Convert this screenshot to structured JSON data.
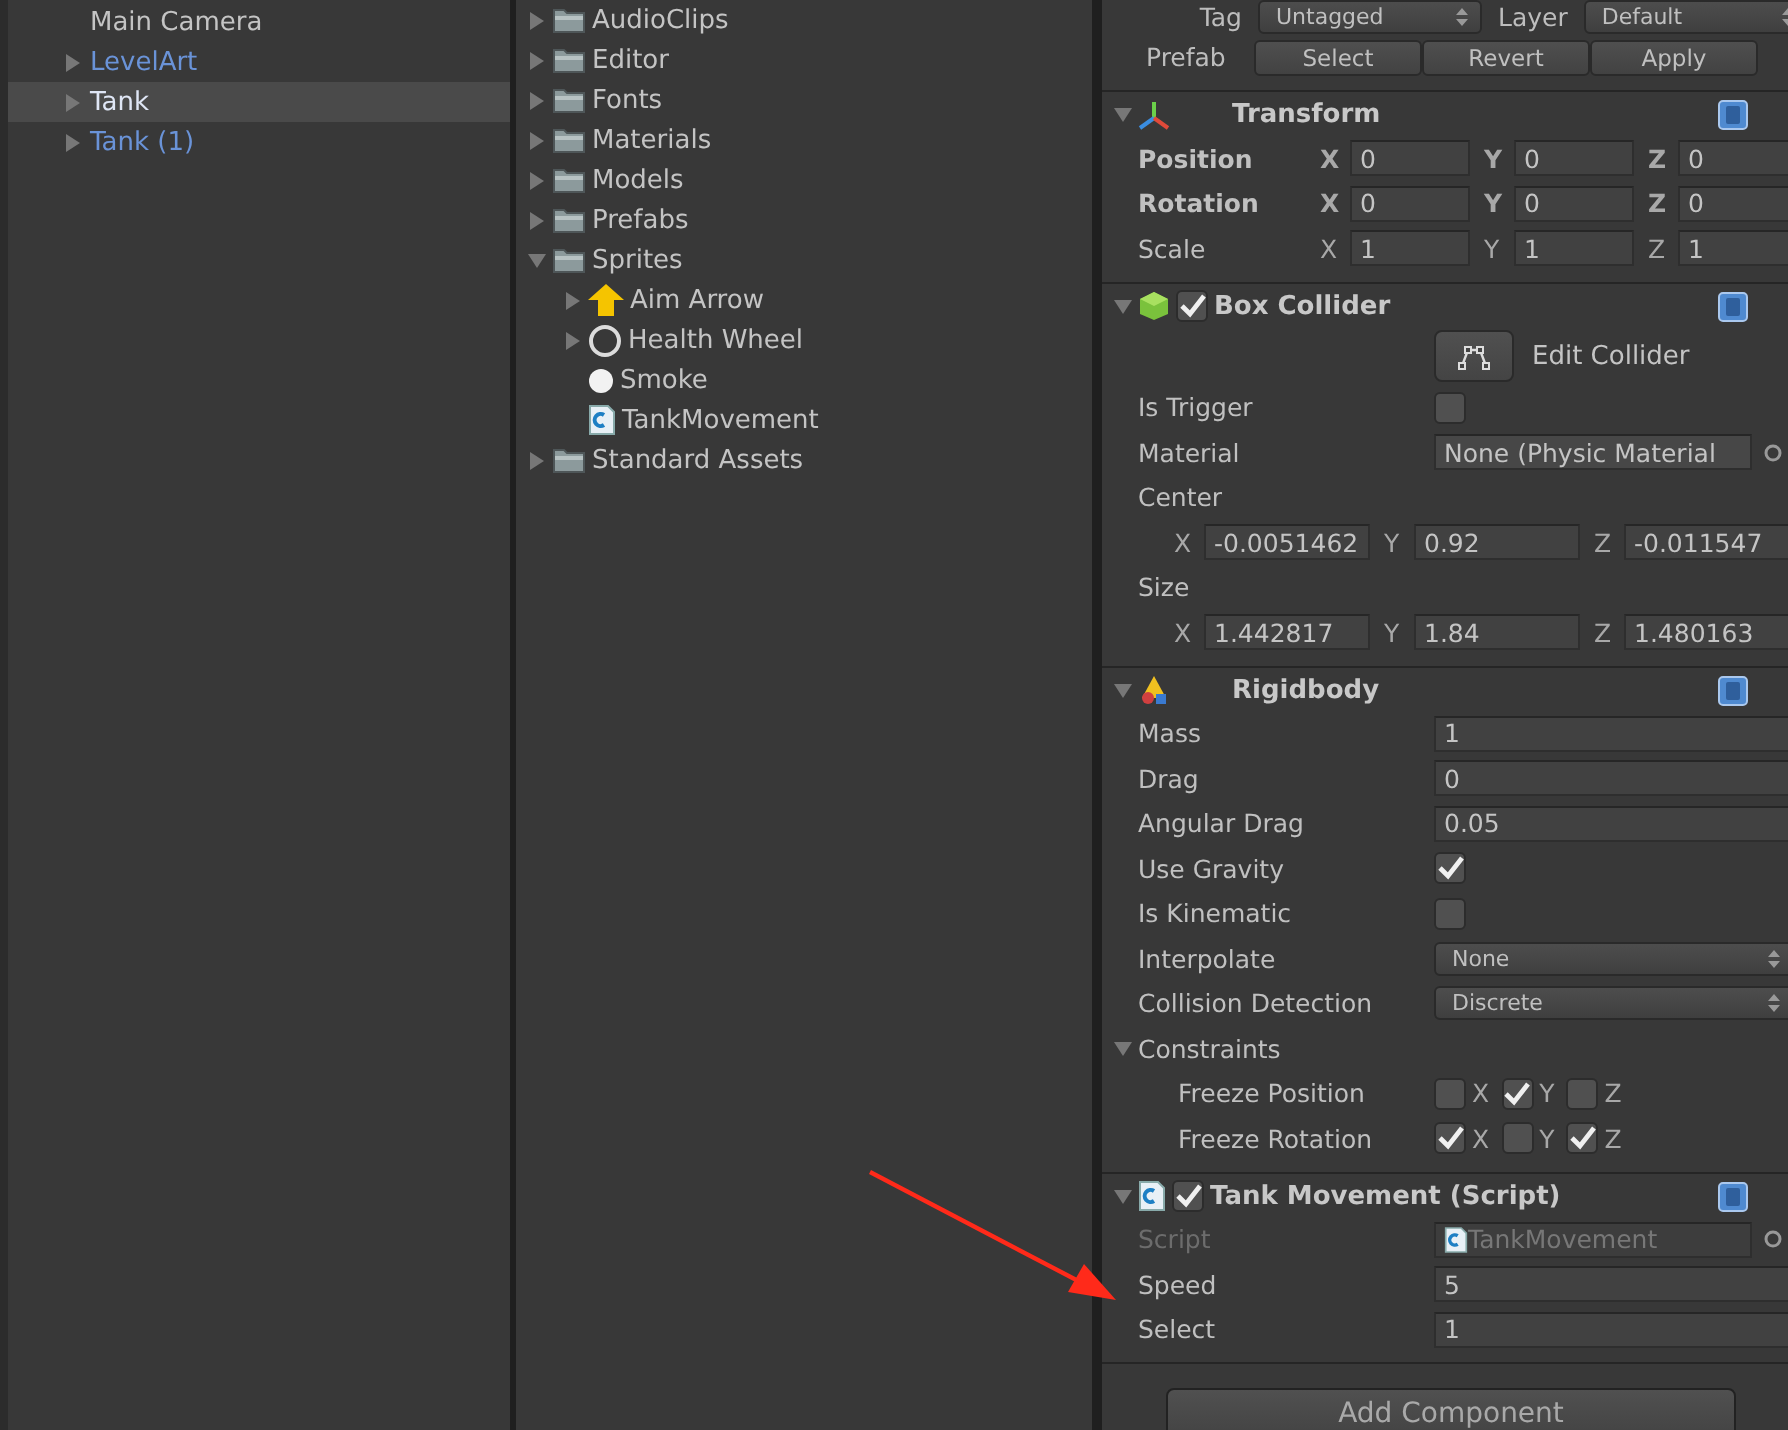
{
  "hierarchy": {
    "items": [
      {
        "label": "Main Camera",
        "prefab": false,
        "selected": false
      },
      {
        "label": "LevelArt",
        "prefab": true,
        "selected": false,
        "expanded": false
      },
      {
        "label": "Tank",
        "prefab": true,
        "selected": true,
        "expanded": false
      },
      {
        "label": "Tank (1)",
        "prefab": true,
        "selected": false,
        "expanded": false
      }
    ]
  },
  "project": {
    "items": [
      {
        "label": "AudioClips",
        "kind": "folder",
        "expanded": false
      },
      {
        "label": "Editor",
        "kind": "folder",
        "expanded": false
      },
      {
        "label": "Fonts",
        "kind": "folder",
        "expanded": false
      },
      {
        "label": "Materials",
        "kind": "folder",
        "expanded": false
      },
      {
        "label": "Models",
        "kind": "folder",
        "expanded": false
      },
      {
        "label": "Prefabs",
        "kind": "folder",
        "expanded": false
      },
      {
        "label": "Sprites",
        "kind": "folder",
        "expanded": true,
        "children": [
          {
            "label": "Aim Arrow",
            "kind": "arrow",
            "expanded": false
          },
          {
            "label": "Health Wheel",
            "kind": "ring",
            "expanded": false
          },
          {
            "label": "Smoke",
            "kind": "dot"
          },
          {
            "label": "TankMovement",
            "kind": "script"
          }
        ]
      },
      {
        "label": "Standard Assets",
        "kind": "folder",
        "expanded": false
      }
    ]
  },
  "inspector": {
    "tag_label": "Tag",
    "tag": "Untagged",
    "layer_label": "Layer",
    "layer": "Default",
    "prefab_label": "Prefab",
    "prefab_buttons": [
      "Select",
      "Revert",
      "Apply"
    ],
    "components": [
      {
        "kind": "transform",
        "title": "Transform",
        "expanded": true,
        "rows": [
          {
            "kind": "vector",
            "label": "Position",
            "bold": true,
            "axes": [
              {
                "axis": "X",
                "value": "0"
              },
              {
                "axis": "Y",
                "value": "0"
              },
              {
                "axis": "Z",
                "value": "0"
              }
            ]
          },
          {
            "kind": "vector",
            "label": "Rotation",
            "bold": true,
            "axes": [
              {
                "axis": "X",
                "value": "0"
              },
              {
                "axis": "Y",
                "value": "0"
              },
              {
                "axis": "Z",
                "value": "0"
              }
            ]
          },
          {
            "kind": "vector",
            "label": "Scale",
            "bold": false,
            "axes": [
              {
                "axis": "X",
                "value": "1"
              },
              {
                "axis": "Y",
                "value": "1"
              },
              {
                "axis": "Z",
                "value": "1"
              }
            ]
          }
        ]
      },
      {
        "kind": "collider",
        "title": "Box Collider",
        "enabled": true,
        "expanded": true,
        "rows": [
          {
            "kind": "button",
            "label": "Edit Collider"
          },
          {
            "kind": "checkbox",
            "label": "Is Trigger",
            "checked": false
          },
          {
            "kind": "object",
            "label": "Material",
            "value": "None (Physic Material",
            "disabled": false
          },
          {
            "kind": "heading",
            "label": "Center"
          },
          {
            "kind": "vector",
            "axes": [
              {
                "axis": "X",
                "value": "-0.0051462"
              },
              {
                "axis": "Y",
                "value": "0.92"
              },
              {
                "axis": "Z",
                "value": "-0.011547"
              }
            ]
          },
          {
            "kind": "heading",
            "label": "Size"
          },
          {
            "kind": "vector",
            "axes": [
              {
                "axis": "X",
                "value": "1.442817"
              },
              {
                "axis": "Y",
                "value": "1.84"
              },
              {
                "axis": "Z",
                "value": "1.480163"
              }
            ]
          }
        ]
      },
      {
        "kind": "rigidbody",
        "title": "Rigidbody",
        "expanded": true,
        "rows": [
          {
            "kind": "field",
            "label": "Mass",
            "value": "1"
          },
          {
            "kind": "field",
            "label": "Drag",
            "value": "0"
          },
          {
            "kind": "field",
            "label": "Angular Drag",
            "value": "0.05"
          },
          {
            "kind": "checkbox",
            "label": "Use Gravity",
            "checked": true
          },
          {
            "kind": "checkbox",
            "label": "Is Kinematic",
            "checked": false
          },
          {
            "kind": "dropdown",
            "label": "Interpolate",
            "value": "None"
          },
          {
            "kind": "dropdown",
            "label": "Collision Detection",
            "value": "Discrete"
          },
          {
            "kind": "foldout",
            "label": "Constraints",
            "expanded": true
          },
          {
            "kind": "toggles",
            "label": "Freeze Position",
            "toggles": [
              {
                "axis": "X",
                "checked": false
              },
              {
                "axis": "Y",
                "checked": true
              },
              {
                "axis": "Z",
                "checked": false
              }
            ]
          },
          {
            "kind": "toggles",
            "label": "Freeze Rotation",
            "toggles": [
              {
                "axis": "X",
                "checked": true
              },
              {
                "axis": "Y",
                "checked": false
              },
              {
                "axis": "Z",
                "checked": true
              }
            ]
          }
        ]
      },
      {
        "kind": "script",
        "title": "Tank Movement (Script)",
        "enabled": true,
        "expanded": true,
        "rows": [
          {
            "kind": "object",
            "label": "Script",
            "value": "TankMovement",
            "disabled": true
          },
          {
            "kind": "field",
            "label": "Speed",
            "value": "5"
          },
          {
            "kind": "field",
            "label": "Select",
            "value": "1"
          }
        ]
      }
    ],
    "add_component": "Add Component"
  }
}
